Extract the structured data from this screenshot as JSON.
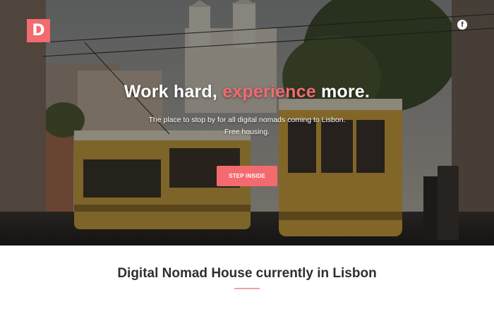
{
  "brand": {
    "logo_letter": "D",
    "accent_color": "#f36a6f"
  },
  "social": {
    "facebook_icon": "facebook-icon",
    "facebook_glyph": "f"
  },
  "hero": {
    "headline_part1": "Work hard, ",
    "headline_accent": "experience",
    "headline_part2": " more.",
    "subtitle_line1": "The place to stop by for all digital nomads coming to Lisbon.",
    "subtitle_line2": "Free housing.",
    "cta_label": "STEP INSIDE"
  },
  "section": {
    "title": "Digital Nomad House currently in Lisbon"
  }
}
